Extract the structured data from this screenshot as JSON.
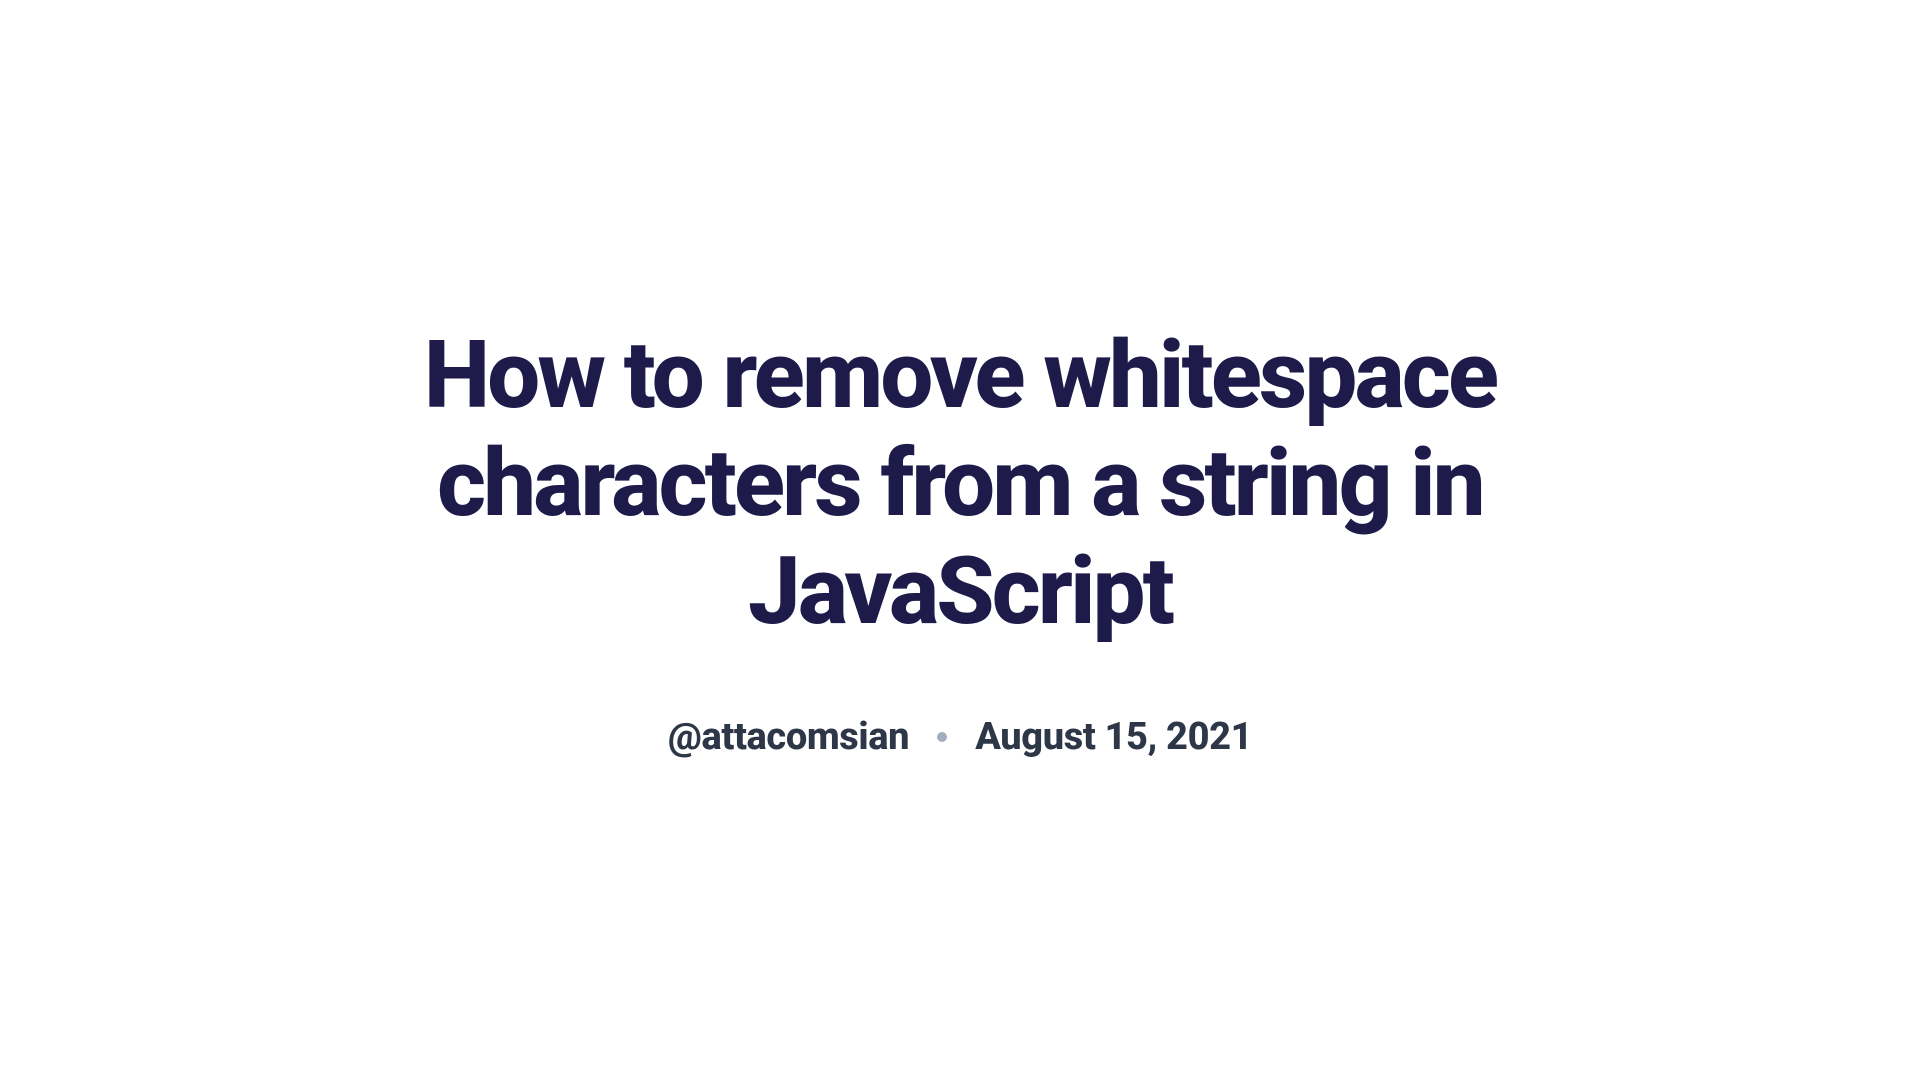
{
  "article": {
    "title": "How to remove whitespace characters from a string in JavaScript",
    "author": "@attacomsian",
    "date": "August 15, 2021"
  }
}
